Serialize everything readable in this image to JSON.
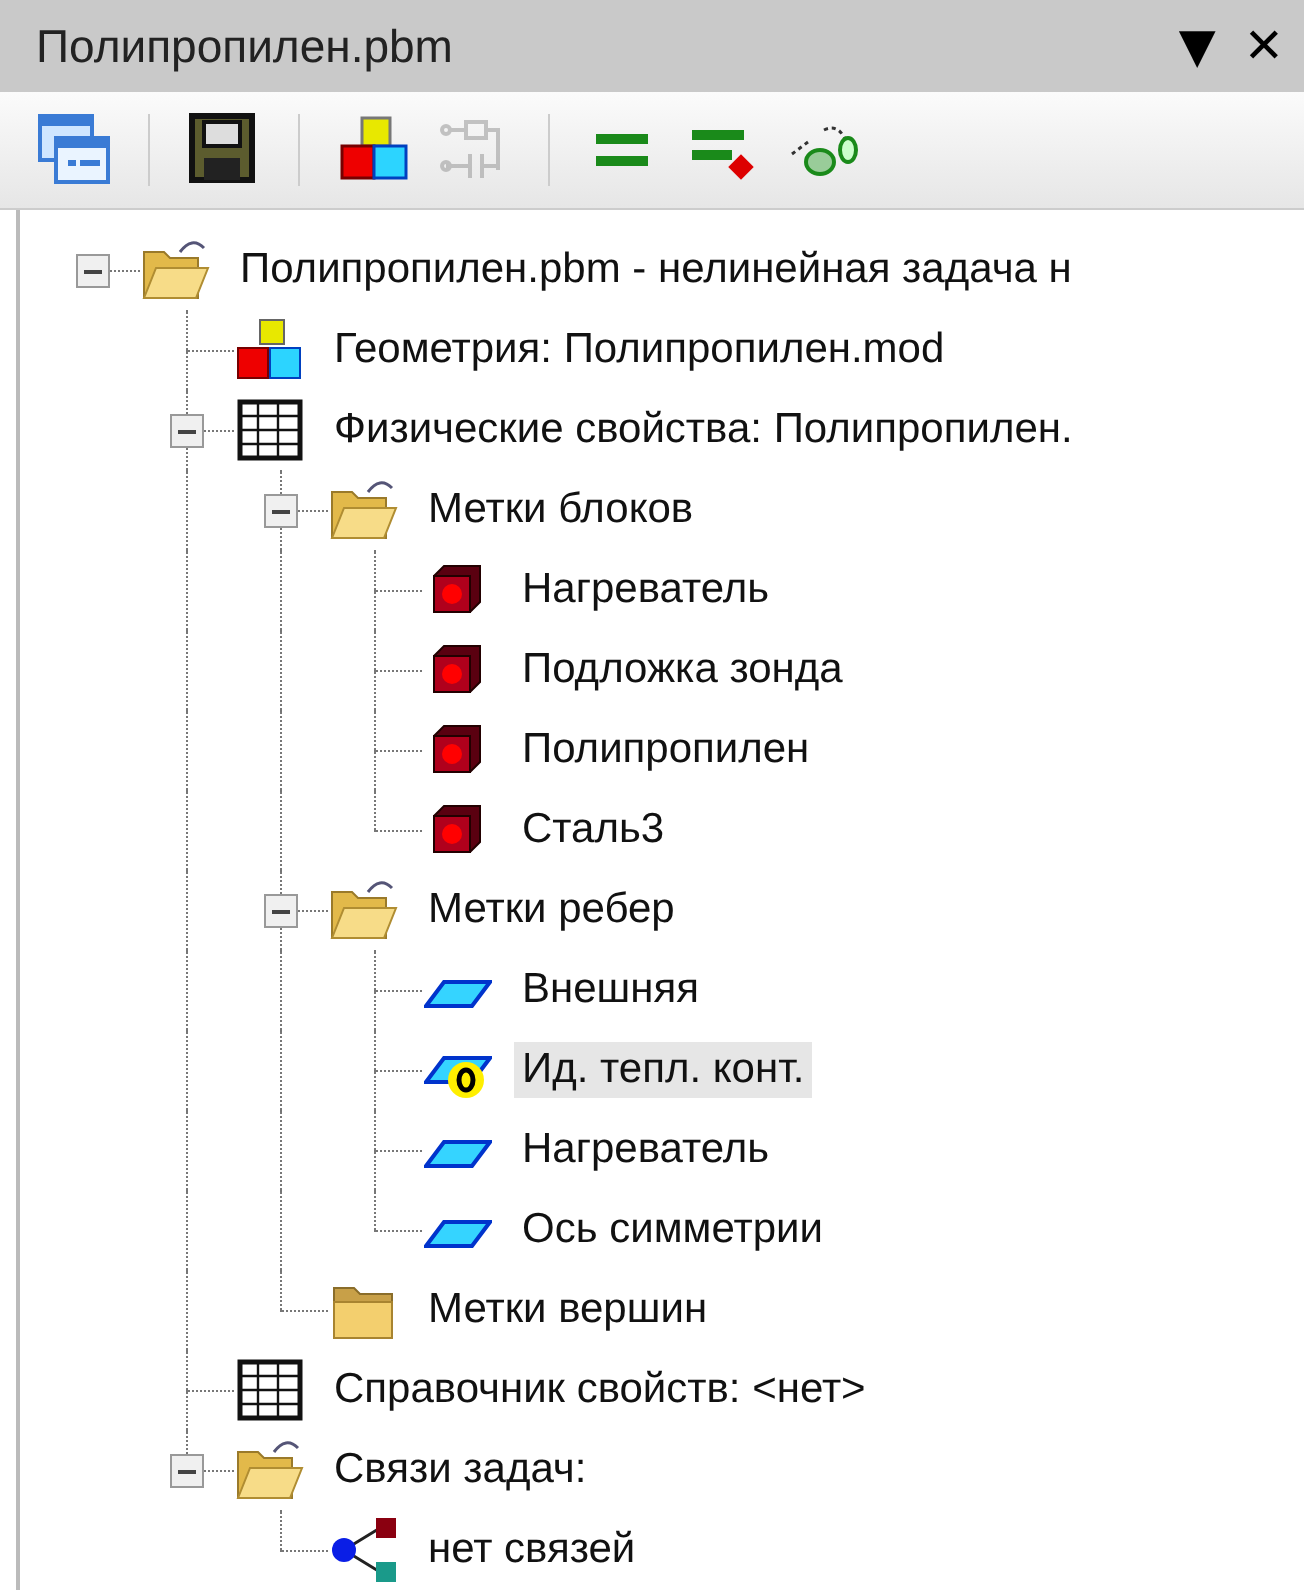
{
  "panel": {
    "title": "Полипропилен.pbm",
    "menu_glyph": "▼",
    "close_glyph": "✕"
  },
  "toolbar": [
    {
      "kind": "windows",
      "disabled": false
    },
    {
      "kind": "separator"
    },
    {
      "kind": "save",
      "disabled": false
    },
    {
      "kind": "separator"
    },
    {
      "kind": "cubes",
      "disabled": false
    },
    {
      "kind": "circuit",
      "disabled": true
    },
    {
      "kind": "separator"
    },
    {
      "kind": "equals",
      "disabled": false
    },
    {
      "kind": "equals-dot",
      "disabled": false
    },
    {
      "kind": "link-graph",
      "disabled": false
    }
  ],
  "tree": [
    {
      "label": "Полипропилен.pbm - нелинейная задача н",
      "kind": "project",
      "expanded": true,
      "selected": false,
      "children": [
        {
          "label": "Геометрия: Полипропилен.mod",
          "kind": "geometry",
          "selected": false
        },
        {
          "label": "Физические свойства: Полипропилен.",
          "kind": "table",
          "expanded": true,
          "selected": false,
          "children": [
            {
              "label": "Метки блоков",
              "kind": "folder-open",
              "expanded": true,
              "selected": false,
              "children": [
                {
                  "label": "Нагреватель",
                  "kind": "block",
                  "selected": false
                },
                {
                  "label": "Подложка зонда",
                  "kind": "block",
                  "selected": false
                },
                {
                  "label": "Полипропилен",
                  "kind": "block",
                  "selected": false
                },
                {
                  "label": "Сталь3",
                  "kind": "block",
                  "selected": false
                }
              ]
            },
            {
              "label": "Метки ребер",
              "kind": "folder-open",
              "expanded": true,
              "selected": false,
              "children": [
                {
                  "label": "Внешняя",
                  "kind": "edge",
                  "selected": false
                },
                {
                  "label": "Ид. тепл. конт.",
                  "kind": "edge-zero",
                  "selected": true
                },
                {
                  "label": "Нагреватель",
                  "kind": "edge",
                  "selected": false
                },
                {
                  "label": "Ось симметрии",
                  "kind": "edge",
                  "selected": false
                }
              ]
            },
            {
              "label": "Метки вершин",
              "kind": "folder",
              "selected": false
            }
          ]
        },
        {
          "label": "Справочник свойств: <нет>",
          "kind": "table",
          "selected": false
        },
        {
          "label": "Связи задач:",
          "kind": "folder-open",
          "expanded": true,
          "selected": false,
          "children": [
            {
              "label": "нет связей",
              "kind": "links",
              "selected": false
            }
          ]
        }
      ]
    }
  ]
}
